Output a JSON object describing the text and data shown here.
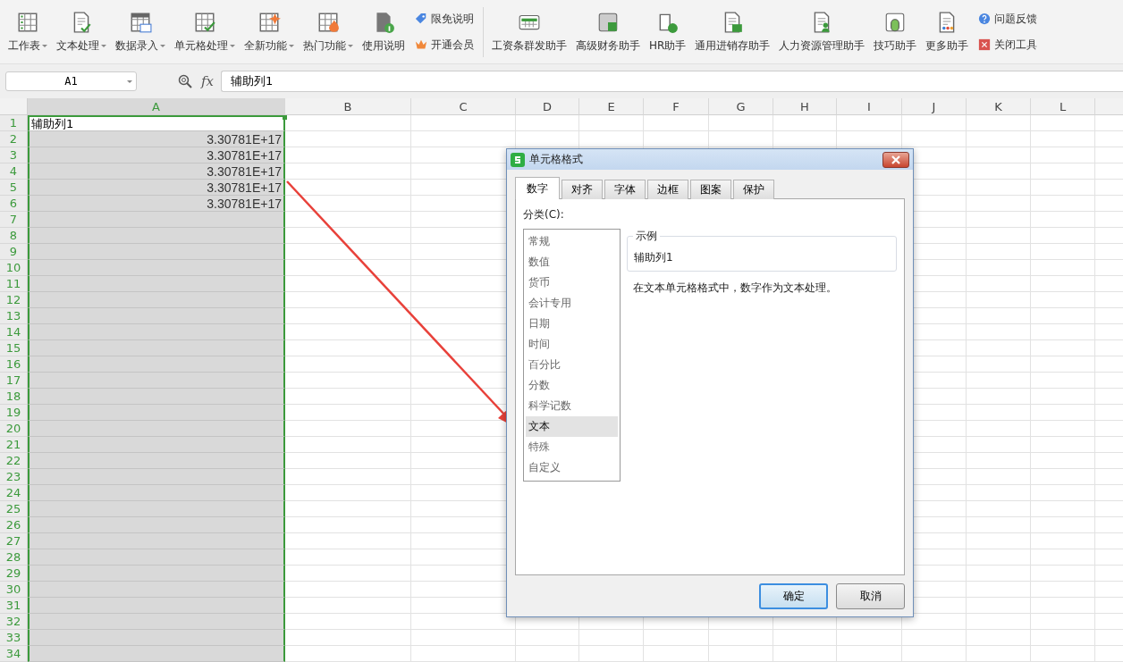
{
  "toolbar": {
    "left_buttons": [
      {
        "label": "工作表",
        "dropdown": true
      },
      {
        "label": "文本处理",
        "dropdown": true
      },
      {
        "label": "数据录入",
        "dropdown": true
      },
      {
        "label": "单元格处理",
        "dropdown": true
      },
      {
        "label": "全新功能",
        "dropdown": true
      },
      {
        "label": "热门功能",
        "dropdown": true
      },
      {
        "label": "使用说明",
        "dropdown": false
      }
    ],
    "left_links": [
      "限免说明",
      "开通会员"
    ],
    "right_buttons": [
      "工资条群发助手",
      "高级财务助手",
      "HR助手",
      "通用进销存助手",
      "人力资源管理助手",
      "技巧助手",
      "更多助手"
    ],
    "right_links": [
      "问题反馈",
      "关闭工具"
    ]
  },
  "formula_bar": {
    "name_box": "A1",
    "fx": "fx",
    "value": "辅助列1"
  },
  "sheet": {
    "columns": [
      {
        "label": "A",
        "selected": true
      },
      {
        "label": "B",
        "selected": false
      },
      {
        "label": "C",
        "selected": false
      },
      {
        "label": "D",
        "selected": false
      },
      {
        "label": "E",
        "selected": false
      },
      {
        "label": "F",
        "selected": false
      },
      {
        "label": "G",
        "selected": false
      },
      {
        "label": "H",
        "selected": false
      },
      {
        "label": "I",
        "selected": false
      },
      {
        "label": "J",
        "selected": false
      },
      {
        "label": "K",
        "selected": false
      },
      {
        "label": "L",
        "selected": false
      }
    ],
    "rows": [
      {
        "header": "1",
        "selected": true,
        "cells": [
          {
            "text": "辅助列1",
            "kind": "text",
            "active": true
          }
        ]
      },
      {
        "header": "2",
        "selected": true,
        "cells": [
          {
            "text": "3.30781E+17",
            "kind": "number",
            "active": false
          }
        ]
      },
      {
        "header": "3",
        "selected": true,
        "cells": [
          {
            "text": "3.30781E+17",
            "kind": "number",
            "active": false
          }
        ]
      },
      {
        "header": "4",
        "selected": true,
        "cells": [
          {
            "text": "3.30781E+17",
            "kind": "number",
            "active": false
          }
        ]
      },
      {
        "header": "5",
        "selected": true,
        "cells": [
          {
            "text": "3.30781E+17",
            "kind": "number",
            "active": false
          }
        ]
      },
      {
        "header": "6",
        "selected": true,
        "cells": [
          {
            "text": "3.30781E+17",
            "kind": "number",
            "active": false
          }
        ]
      },
      {
        "header": "7",
        "selected": true
      },
      {
        "header": "8",
        "selected": true
      },
      {
        "header": "9",
        "selected": true
      },
      {
        "header": "10",
        "selected": true
      },
      {
        "header": "11",
        "selected": true
      },
      {
        "header": "12",
        "selected": true
      },
      {
        "header": "13",
        "selected": true
      },
      {
        "header": "14",
        "selected": true
      },
      {
        "header": "15",
        "selected": true
      },
      {
        "header": "16",
        "selected": true
      },
      {
        "header": "17",
        "selected": true
      },
      {
        "header": "18",
        "selected": true
      },
      {
        "header": "19",
        "selected": true
      },
      {
        "header": "20",
        "selected": true
      },
      {
        "header": "21",
        "selected": true
      },
      {
        "header": "22",
        "selected": true
      },
      {
        "header": "23",
        "selected": true
      },
      {
        "header": "24",
        "selected": true
      },
      {
        "header": "25",
        "selected": true
      },
      {
        "header": "26",
        "selected": true
      },
      {
        "header": "27",
        "selected": true
      },
      {
        "header": "28",
        "selected": true
      },
      {
        "header": "29",
        "selected": true
      },
      {
        "header": "30",
        "selected": true
      },
      {
        "header": "31",
        "selected": true
      },
      {
        "header": "32",
        "selected": true
      },
      {
        "header": "33",
        "selected": true
      },
      {
        "header": "34",
        "selected": true
      }
    ]
  },
  "dialog": {
    "title": "单元格格式",
    "tabs": [
      {
        "label": "数字",
        "selected": true
      },
      {
        "label": "对齐",
        "selected": false
      },
      {
        "label": "字体",
        "selected": false
      },
      {
        "label": "边框",
        "selected": false
      },
      {
        "label": "图案",
        "selected": false
      },
      {
        "label": "保护",
        "selected": false
      }
    ],
    "category_label": "分类(C):",
    "categories": [
      {
        "label": "常规",
        "selected": false
      },
      {
        "label": "数值",
        "selected": false
      },
      {
        "label": "货币",
        "selected": false
      },
      {
        "label": "会计专用",
        "selected": false
      },
      {
        "label": "日期",
        "selected": false
      },
      {
        "label": "时间",
        "selected": false
      },
      {
        "label": "百分比",
        "selected": false
      },
      {
        "label": "分数",
        "selected": false
      },
      {
        "label": "科学记数",
        "selected": false
      },
      {
        "label": "文本",
        "selected": true
      },
      {
        "label": "特殊",
        "selected": false
      },
      {
        "label": "自定义",
        "selected": false
      }
    ],
    "sample": {
      "legend": "示例",
      "value": "辅助列1"
    },
    "description": "在文本单元格格式中，数字作为文本处理。",
    "buttons": [
      {
        "label": "确定",
        "kind": "primary"
      },
      {
        "label": "取消",
        "kind": "normal"
      }
    ]
  }
}
